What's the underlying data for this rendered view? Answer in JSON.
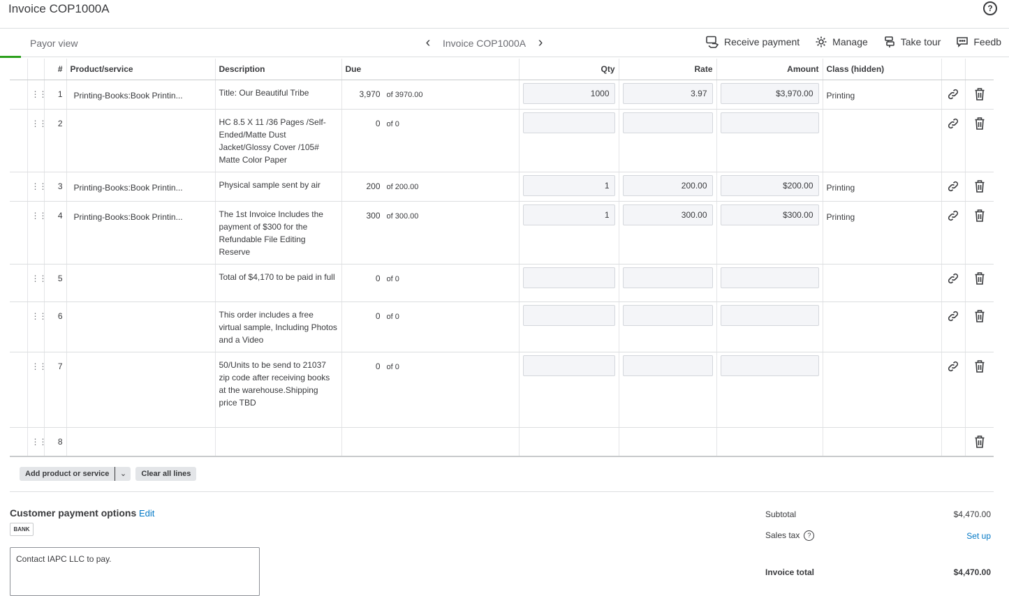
{
  "header": {
    "title": "Invoice COP1000A",
    "help_icon": "?"
  },
  "toolbar": {
    "payor_view": "Payor view",
    "invoice_nav": "Invoice COP1000A",
    "actions": [
      "Receive payment",
      "Manage",
      "Take tour",
      "Feedb"
    ]
  },
  "table": {
    "headers": {
      "num": "#",
      "product": "Product/service",
      "description": "Description",
      "due": "Due",
      "qty": "Qty",
      "rate": "Rate",
      "amount": "Amount",
      "class": "Class (hidden)"
    },
    "rows": [
      {
        "num": "1",
        "product": "Printing-Books:Book Printin...",
        "description": "Title: Our Beautiful Tribe",
        "due": "3,970",
        "due_of": "of 3970.00",
        "qty": "1000",
        "rate": "3.97",
        "amount": "$3,970.00",
        "class": "Printing",
        "has_fields": true,
        "has_link": true
      },
      {
        "num": "2",
        "product": "",
        "description": "HC 8.5 X 11 /36 Pages /Self-Ended/Matte Dust Jacket/Glossy Cover /105# Matte Color Paper",
        "due": "0",
        "due_of": "of 0",
        "qty": "",
        "rate": "",
        "amount": "",
        "class": "",
        "has_fields": true,
        "has_link": true
      },
      {
        "num": "3",
        "product": "Printing-Books:Book Printin...",
        "description": "Physical sample sent by air",
        "due": "200",
        "due_of": "of 200.00",
        "qty": "1",
        "rate": "200.00",
        "amount": "$200.00",
        "class": "Printing",
        "has_fields": true,
        "has_link": true
      },
      {
        "num": "4",
        "product": "Printing-Books:Book Printin...",
        "description": "The 1st Invoice Includes the payment of $300 for the Refundable File Editing Reserve",
        "due": "300",
        "due_of": "of 300.00",
        "qty": "1",
        "rate": "300.00",
        "amount": "$300.00",
        "class": "Printing",
        "has_fields": true,
        "has_link": true
      },
      {
        "num": "5",
        "product": "",
        "description": "Total of $4,170  to be paid in full",
        "due": "0",
        "due_of": "of 0",
        "qty": "",
        "rate": "",
        "amount": "",
        "class": "",
        "has_fields": true,
        "has_link": true
      },
      {
        "num": "6",
        "product": "",
        "description": "This order includes a free virtual sample, Including Photos and a Video",
        "due": "0",
        "due_of": "of 0",
        "qty": "",
        "rate": "",
        "amount": "",
        "class": "",
        "has_fields": true,
        "has_link": true
      },
      {
        "num": "7",
        "product": "",
        "description": "50/Units to be send to 21037 zip code after receiving books at the warehouse.Shipping price TBD",
        "due": "0",
        "due_of": "of 0",
        "qty": "",
        "rate": "",
        "amount": "",
        "class": "",
        "has_fields": true,
        "has_link": true
      },
      {
        "num": "8",
        "product": "",
        "description": "",
        "due": "",
        "due_of": "",
        "qty": "",
        "rate": "",
        "amount": "",
        "class": "",
        "has_fields": false,
        "has_link": false
      }
    ]
  },
  "line_actions": {
    "add": "Add product or service",
    "clear": "Clear all lines"
  },
  "payment_options": {
    "title": "Customer payment options",
    "edit": "Edit",
    "badge": "BANK",
    "memo": "Contact IAPC LLC to pay."
  },
  "totals": {
    "subtotal_label": "Subtotal",
    "subtotal": "$4,470.00",
    "sales_tax_label": "Sales tax",
    "sales_tax_help": "?",
    "sales_tax_action": "Set up",
    "total_label": "Invoice total",
    "total": "$4,470.00"
  },
  "colors": {
    "accent_green": "#2ca01c",
    "link_blue": "#0077c5",
    "field_bg": "#f4f5f8"
  }
}
